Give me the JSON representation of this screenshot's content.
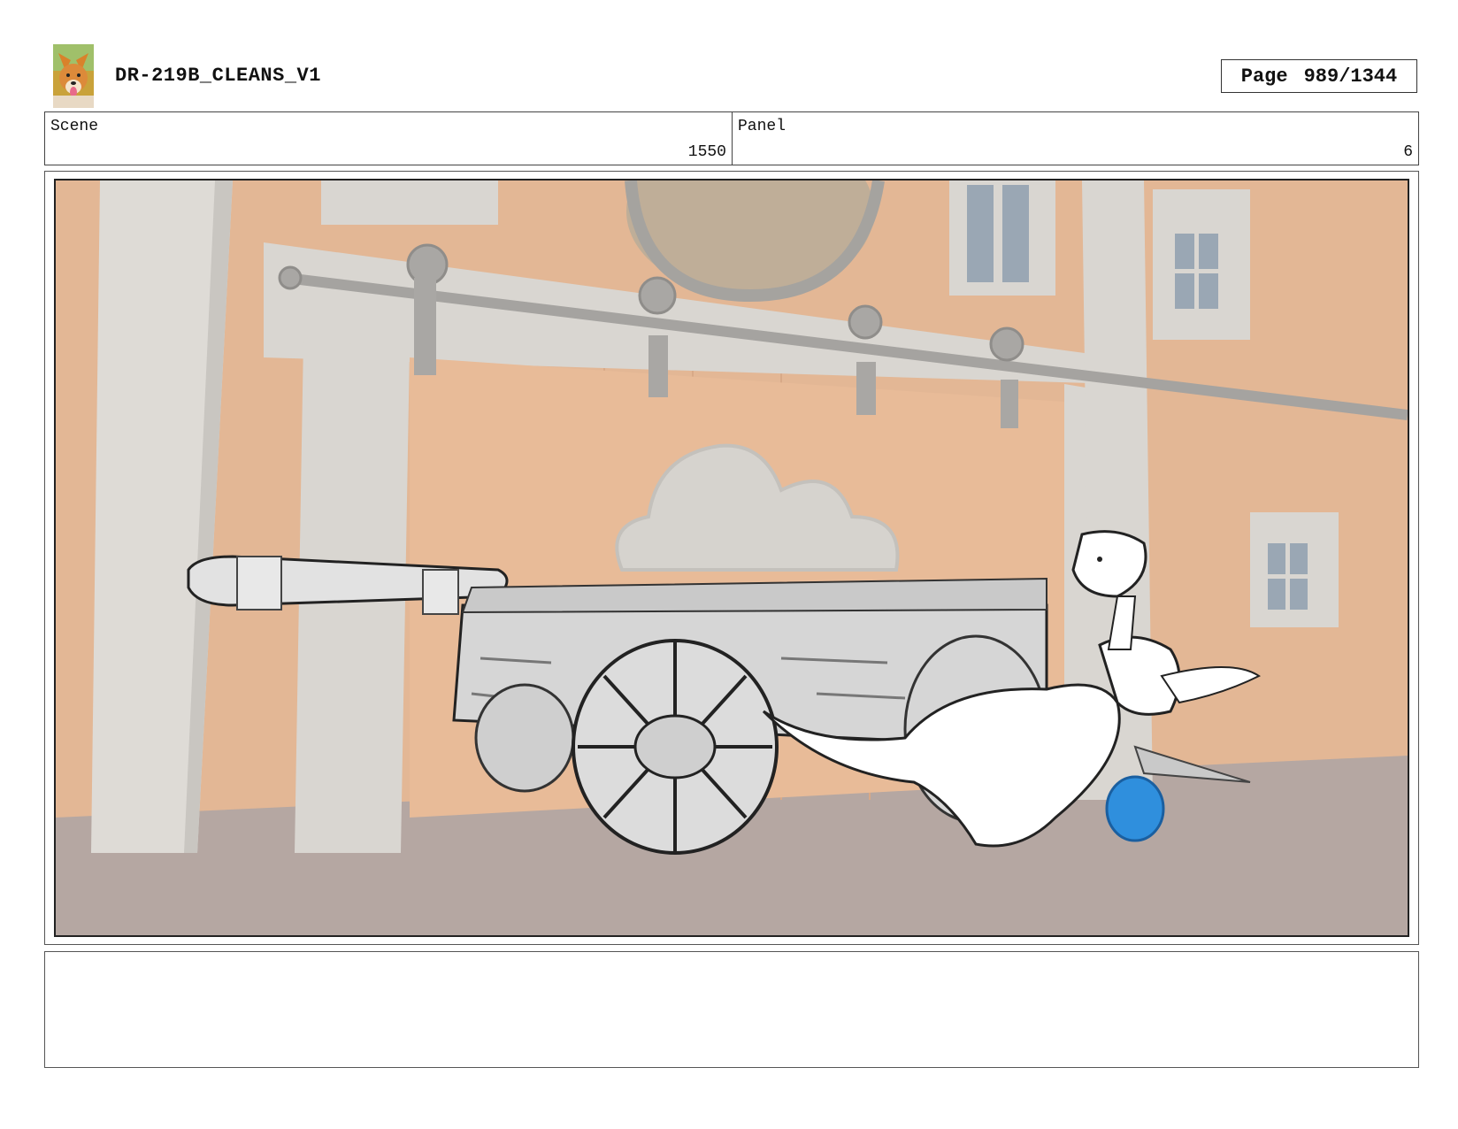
{
  "header": {
    "title": "DR-219B_CLEANS_V1",
    "page_label": "Page",
    "page_value": "989/1344",
    "logo_icon": "dog-avatar-icon"
  },
  "info": {
    "scene_label": "Scene",
    "scene_value": "1550",
    "panel_label": "Panel",
    "panel_value": "6"
  },
  "frame": {
    "image_icon": "storyboard-sketch-wagon-kangaroo",
    "colors": {
      "wall": "#e3b795",
      "trim": "#d9d6d1",
      "ground": "#b5a7a2",
      "ball": "#2f8fdd"
    }
  },
  "notes": {
    "text": ""
  }
}
